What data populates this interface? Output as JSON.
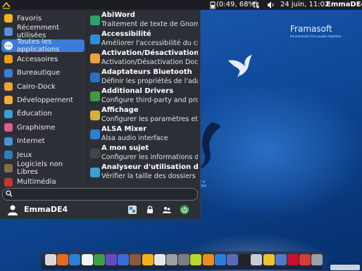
{
  "top_panel": {
    "battery": "(0:49, 68%)",
    "datetime": "24 juin, 11:02",
    "username": "EmmaDE4"
  },
  "desktop": {
    "brand_name": "Framasoft",
    "brand_tagline": "les aventures d'un peuple migrateur",
    "tagline_line1": "E 4",
    "tagline_line2": "DE4"
  },
  "menu": {
    "categories": [
      {
        "label": "Favoris",
        "icon": "star-icon",
        "color": "#f3b21c"
      },
      {
        "label": "Récemment utilisées",
        "icon": "folder-recent-icon",
        "color": "#5b8fd6"
      },
      {
        "label": "Toutes les applications",
        "icon": "all-apps-icon",
        "color": "#ffffff",
        "active": true
      },
      {
        "label": "Accessoires",
        "icon": "accessories-icon",
        "color": "#f39c12"
      },
      {
        "label": "Bureautique",
        "icon": "office-icon",
        "color": "#3b7dd8"
      },
      {
        "label": "Cairo-Dock",
        "icon": "cairo-dock-icon",
        "color": "#e8a33a"
      },
      {
        "label": "Développement",
        "icon": "development-icon",
        "color": "#f2a93b"
      },
      {
        "label": "Éducation",
        "icon": "education-icon",
        "color": "#3aa0d8"
      },
      {
        "label": "Graphisme",
        "icon": "graphics-icon",
        "color": "#e05b9b"
      },
      {
        "label": "Internet",
        "icon": "internet-icon",
        "color": "#4a8fd8"
      },
      {
        "label": "Jeux",
        "icon": "games-icon",
        "color": "#2c7fb8"
      },
      {
        "label": "Logiciels non Libres",
        "icon": "nonfree-icon",
        "color": "#8a6b4a"
      },
      {
        "label": "Multimédia",
        "icon": "multimedia-icon",
        "color": "#c0392b"
      }
    ],
    "apps": [
      {
        "name": "AbiWord",
        "desc": "Traitement de texte de Gnome...",
        "icon": "abiword-icon",
        "color": "#2ea36a"
      },
      {
        "name": "Accessibilité",
        "desc": "Améliorer l'accessibilité du cla...",
        "icon": "accessibility-icon",
        "color": "#2a8fd8"
      },
      {
        "name": "Activation/Désactivation Doc...",
        "desc": "Activation/Désactivation Dock ...",
        "icon": "cairo-dock-toggle-icon",
        "color": "#e8a33a"
      },
      {
        "name": "Adaptateurs Bluetooth",
        "desc": "Définir les propriétés de l'adap...",
        "icon": "bluetooth-icon",
        "color": "#2a6fc4"
      },
      {
        "name": "Additional Drivers",
        "desc": "Configure third-party and prop...",
        "icon": "drivers-icon",
        "color": "#3f9b3f"
      },
      {
        "name": "Affichage",
        "desc": "Configurer les paramètres et l...",
        "icon": "display-icon",
        "color": "#d4b23a"
      },
      {
        "name": "ALSA Mixer",
        "desc": "Alsa audio interface",
        "icon": "alsa-mixer-icon",
        "color": "#2a7fd8"
      },
      {
        "name": "À mon sujet",
        "desc": "Configurer les informations de...",
        "icon": "about-me-icon",
        "color": "#444444"
      },
      {
        "name": "Analyseur d'utilisation de ...",
        "desc": "Vérifier la taille des dossiers et...",
        "icon": "disk-usage-icon",
        "color": "#3aa0d8"
      }
    ],
    "search": {
      "value": ""
    },
    "user": {
      "name": "EmmaDE4"
    }
  },
  "dock": {
    "items": [
      {
        "icon": "home-folder-icon",
        "color": "#d9d9d9"
      },
      {
        "icon": "firefox-icon",
        "color": "#e66a1f"
      },
      {
        "icon": "software-center-icon",
        "color": "#2a7fd8"
      },
      {
        "icon": "text-editor-icon",
        "color": "#f2f2f2"
      },
      {
        "icon": "libreoffice-icon",
        "color": "#3aa04a"
      },
      {
        "icon": "video-editor-icon",
        "color": "#6a4ac4"
      },
      {
        "icon": "media-player-icon",
        "color": "#3a6ad8"
      },
      {
        "icon": "gimp-icon",
        "color": "#8a5a3a"
      },
      {
        "icon": "star-app-icon",
        "color": "#f2b21c"
      },
      {
        "icon": "tux-icon",
        "color": "#e8e8e8"
      },
      {
        "icon": "settings-icon",
        "color": "#9aa0a8"
      },
      {
        "icon": "scanner-icon",
        "color": "#7a8088"
      },
      {
        "icon": "lime-app-icon",
        "color": "#b8d82a"
      },
      {
        "icon": "vlc-icon",
        "color": "#f08a1c"
      },
      {
        "icon": "help-icon",
        "color": "#2a7fd8"
      },
      {
        "icon": "workspace-icon",
        "color": "#5a6ab8"
      },
      {
        "icon": "terminal-icon",
        "color": "#222222"
      },
      {
        "icon": "files-icon",
        "color": "#c8cdd4"
      },
      {
        "icon": "folder-icon",
        "color": "#f2c22a"
      },
      {
        "icon": "package-icon",
        "color": "#4a7ac8"
      },
      {
        "icon": "debian-icon",
        "color": "#c8102e"
      },
      {
        "icon": "power-icon",
        "color": "#d83a3a"
      },
      {
        "icon": "trash-icon",
        "color": "#9aa0a8"
      }
    ]
  },
  "colors": {
    "accent": "#3d7bd8",
    "menu_bg": "#2c2f35",
    "panel_bg": "#1b1d22"
  }
}
